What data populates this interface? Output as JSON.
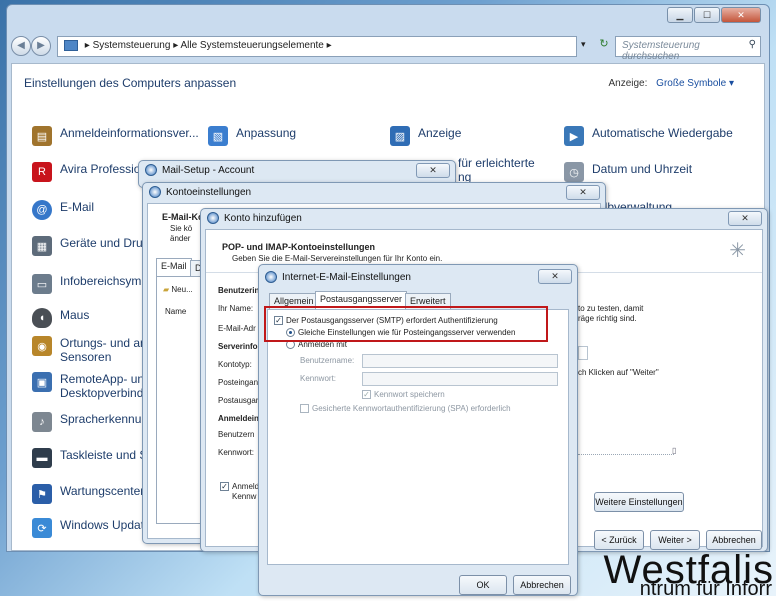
{
  "control_panel": {
    "breadcrumb": [
      "Systemsteuerung",
      "Alle Systemsteuerungselemente"
    ],
    "search_placeholder": "Systemsteuerung durchsuchen",
    "heading": "Einstellungen des Computers anpassen",
    "view_label": "Anzeige:",
    "view_value": "Große Symbole ▾",
    "items_col1": [
      {
        "label": "Anmeldeinformationsver...",
        "icon": "credential-manager-icon",
        "color": "#a0742d"
      },
      {
        "label": "Avira Profession",
        "icon": "avira-icon",
        "color": "#c8141c"
      },
      {
        "label": "E-Mail",
        "icon": "mail-icon",
        "color": "#3677c9"
      },
      {
        "label": "Geräte und Druc",
        "icon": "devices-printers-icon",
        "color": "#5d6b7a"
      },
      {
        "label": "Infobereichsymb",
        "icon": "notification-area-icon",
        "color": "#6c7c8c"
      },
      {
        "label": "Maus",
        "icon": "mouse-icon",
        "color": "#4a4f55"
      },
      {
        "label": "Ortungs- und an",
        "label2": "Sensoren",
        "icon": "location-sensors-icon",
        "color": "#b8862a"
      },
      {
        "label": "RemoteApp- und",
        "label2": "Desktopverbindu",
        "icon": "remoteapp-icon",
        "color": "#3b6fb0"
      },
      {
        "label": "Spracherkennung",
        "icon": "speech-recognition-icon",
        "color": "#7d8791"
      },
      {
        "label": "Taskleiste und Sta",
        "icon": "taskbar-icon",
        "color": "#2f3d4c"
      },
      {
        "label": "Wartungscenter",
        "icon": "action-center-flag-icon",
        "color": "#2b5ea8"
      },
      {
        "label": "Windows Update",
        "icon": "windows-update-icon",
        "color": "#3a8ad6"
      }
    ],
    "item_personalization": "Anpassung",
    "item_display": "Anzeige",
    "item_accessibility": "für erleichterte",
    "item_accessibility2": "ng",
    "item_autoplay": "Automatische Wiedergabe",
    "item_datetime": "Datum und Uhrzeit",
    "item_partial": "ilbverwaltung"
  },
  "mail_setup": {
    "title": "Mail-Setup - Account"
  },
  "konto_einstellungen": {
    "title": "Kontoeinstellungen",
    "section_title": "E-Mail-Ko",
    "desc1": "Sie kö",
    "desc2": "änder",
    "tab_email": "E-Mail",
    "tab_d": "Da",
    "new_button": "Neu...",
    "col_name": "Name"
  },
  "konto_hinzufuegen": {
    "title": "Konto hinzufügen",
    "header_title": "POP- und IMAP-Kontoeinstellungen",
    "header_sub": "Geben Sie die E-Mail-Servereinstellungen für Ihr Konto ein.",
    "labels": [
      "Benutzerin",
      "Ihr Name:",
      "E-Mail-Adr",
      "Serverinfor",
      "Kontotyp:",
      "Posteingan",
      "Postausgan",
      "Anmeldein",
      "Benutzern",
      "Kennwort:"
    ],
    "right_text1": "to zu testen, damit",
    "right_text2": "räge richtig sind.",
    "right_text3": "ch Klicken auf \"Weiter\"",
    "remember_chk": "Anmeld",
    "remember_chk2": "Kennw",
    "more_settings": "Weitere Einstellungen",
    "back": "< Zurück",
    "next": "Weiter >",
    "cancel": "Abbrechen"
  },
  "internet_email": {
    "title": "Internet-E-Mail-Einstellungen",
    "tabs": [
      "Allgemein",
      "Postausgangsserver",
      "Erweitert"
    ],
    "smtp_auth": "Der Postausgangsserver (SMTP) erfordert Authentifizierung",
    "same_settings": "Gleiche Einstellungen wie für Posteingangsserver verwenden",
    "login_with": "Anmelden mit",
    "username_label": "Benutzername:",
    "password_label": "Kennwort:",
    "remember_password": "Kennwort speichern",
    "spa": "Gesicherte Kennwortauthentifizierung (SPA) erforderlich",
    "ok": "OK",
    "cancel": "Abbrechen"
  },
  "background": {
    "big_text": "Westfalis",
    "small_text": "ntrum für Inforr"
  },
  "colors": {
    "highlight_box": "#c0181a",
    "link": "#1a4fa0"
  }
}
